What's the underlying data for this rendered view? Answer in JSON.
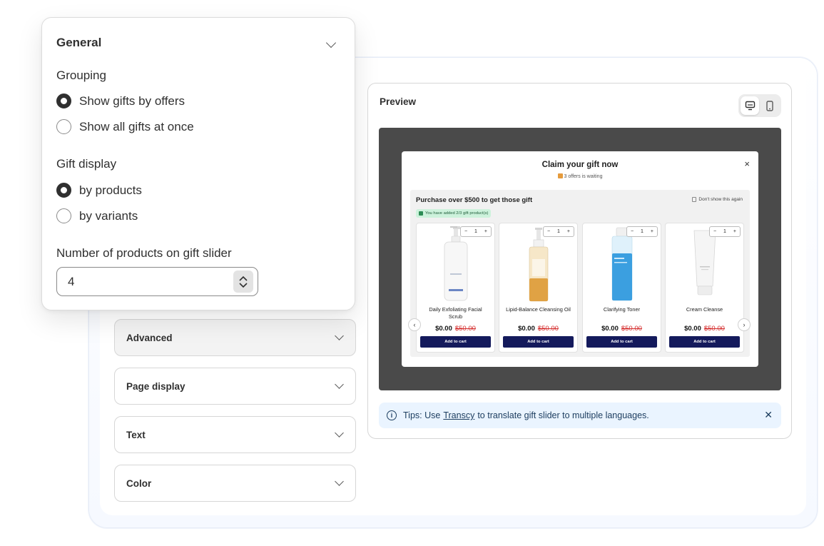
{
  "general": {
    "title": "General",
    "grouping_label": "Grouping",
    "grouping_options": [
      "Show gifts by offers",
      "Show all gifts at once"
    ],
    "gift_display_label": "Gift display",
    "gift_display_options": [
      "by products",
      "by variants"
    ],
    "slider_label": "Number of products on gift slider",
    "slider_value": "4"
  },
  "sections": [
    "Advanced",
    "Page display",
    "Text",
    "Color"
  ],
  "preview": {
    "title": "Preview",
    "modal": {
      "title": "Claim your gift now",
      "subtitle": "3 offers is waiting",
      "close": "×",
      "offer_title": "Purchase over $500 to get those gift",
      "dont_show": "Don't show this again",
      "added_badge": "You have added 2/3 gift product(s)",
      "products": [
        {
          "name": "Daily Exfoliating Facial Scrub",
          "price": "$0.00",
          "old_price": "$50.00",
          "qty": "1",
          "button": "Add to cart"
        },
        {
          "name": "Lipid-Balance Cleansing Oil",
          "price": "$0.00",
          "old_price": "$50.00",
          "qty": "1",
          "button": "Add to cart"
        },
        {
          "name": "Clarifying Toner",
          "price": "$0.00",
          "old_price": "$50.00",
          "qty": "1",
          "button": "Add to cart"
        },
        {
          "name": "Cream Cleanse",
          "price": "$0.00",
          "old_price": "$50.00",
          "qty": "1",
          "button": "Add to cart"
        }
      ],
      "qty_minus": "−",
      "qty_plus": "+",
      "prev_arrow": "‹",
      "next_arrow": "›"
    },
    "tips": {
      "prefix": "Tips: Use",
      "link": "Transcy",
      "suffix": "to translate gift slider to multiple languages.",
      "close": "✕"
    }
  },
  "colors": {
    "button_navy": "#141a5c",
    "old_price_red": "#d42b2b",
    "tips_bg": "#eaf4ff",
    "stage_bg": "#4a4a4a"
  }
}
